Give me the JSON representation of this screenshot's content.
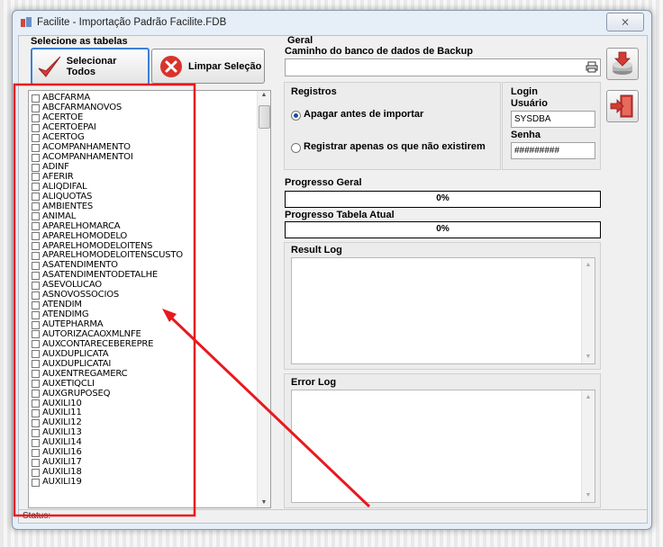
{
  "window": {
    "title": "Facilite - Importação Padrão Facilite.FDB",
    "close_glyph": "⨯"
  },
  "left": {
    "section_label": "Selecione as tabelas",
    "select_all_label": "Selecionar Todos",
    "clear_label": "Limpar Seleção",
    "tables": [
      "ABCFARMA",
      "ABCFARMANOVOS",
      "ACERTOE",
      "ACERTOEPAI",
      "ACERTOG",
      "ACOMPANHAMENTO",
      "ACOMPANHAMENTOI",
      "ADINF",
      "AFERIR",
      "ALIQDIFAL",
      "ALIQUOTAS",
      "AMBIENTES",
      "ANIMAL",
      "APARELHOMARCA",
      "APARELHOMODELO",
      "APARELHOMODELOITENS",
      "APARELHOMODELOITENSCUSTO",
      "ASATENDIMENTO",
      "ASATENDIMENTODETALHE",
      "ASEVOLUCAO",
      "ASNOVOSSOCIOS",
      "ATENDIM",
      "ATENDIMG",
      "AUTEPHARMA",
      "AUTORIZACAOXMLNFE",
      "AUXCONTARECEBEREPRE",
      "AUXDUPLICATA",
      "AUXDUPLICATAI",
      "AUXENTREGAMERC",
      "AUXETIQCLI",
      "AUXGRUPOSEQ",
      "AUXILI10",
      "AUXILI11",
      "AUXILI12",
      "AUXILI13",
      "AUXILI14",
      "AUXILI16",
      "AUXILI17",
      "AUXILI18",
      "AUXILI19"
    ]
  },
  "right": {
    "geral_label": "Geral",
    "backup_path_label": "Caminho do banco de dados de Backup",
    "backup_path_value": "",
    "registros_label": "Registros",
    "radio_delete_label": "Apagar antes de importar",
    "radio_new_label": "Registrar apenas os que não existirem",
    "login_label": "Login",
    "user_label": "Usuário",
    "user_value": "SYSDBA",
    "password_label": "Senha",
    "password_value": "#########",
    "progress_general_label": "Progresso Geral",
    "progress_general_value": "0%",
    "progress_general_fraction": 0,
    "progress_table_label": "Progresso Tabela Atual",
    "progress_table_value": "0%",
    "progress_table_fraction": 0,
    "result_log_label": "Result Log",
    "error_log_label": "Error Log"
  },
  "status": {
    "text": "Status:"
  },
  "colors": {
    "annotation": "#e8191e",
    "focus": "#3c7fd8"
  }
}
